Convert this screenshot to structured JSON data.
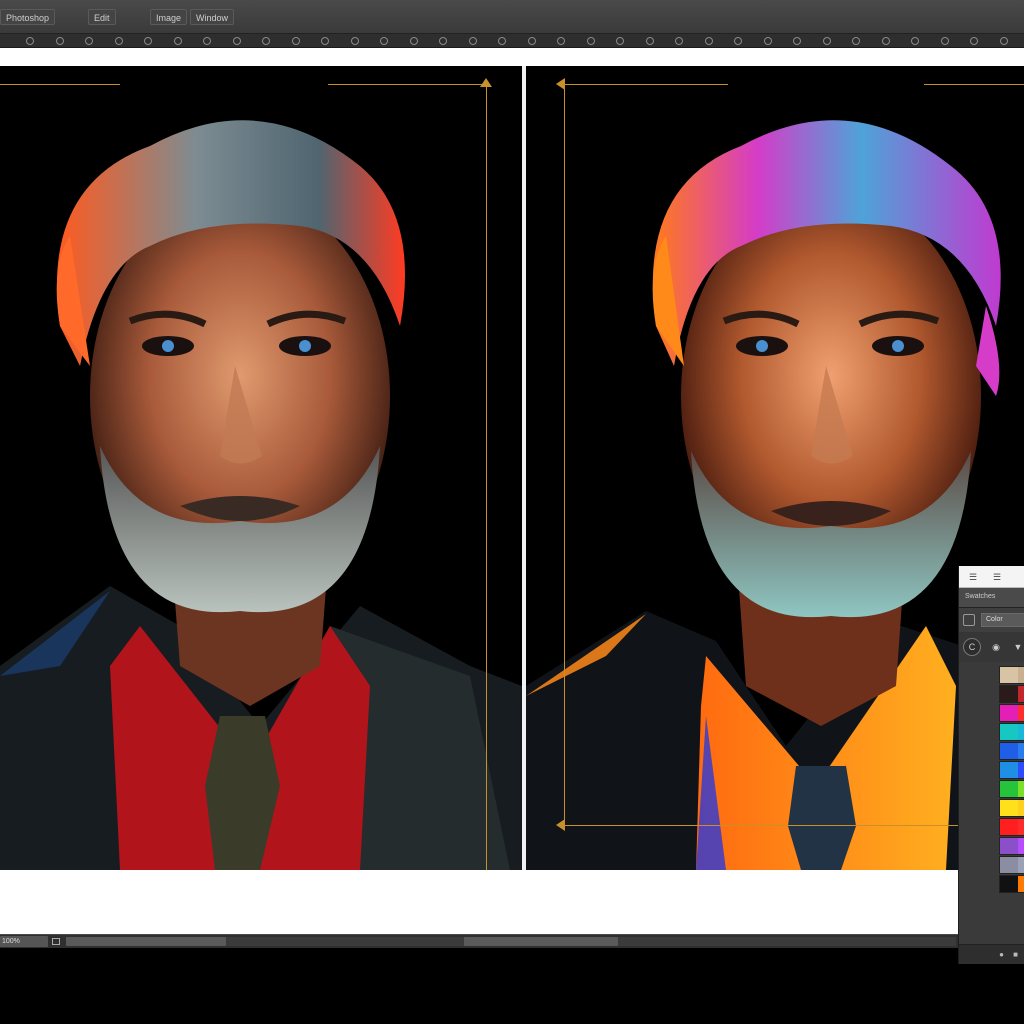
{
  "menubar": {
    "items": [
      "Photoshop",
      "Edit",
      "Image",
      "Window"
    ]
  },
  "optionbar": {
    "button_count": 34
  },
  "canvas": {
    "left_artwork": "portrait-original",
    "right_artwork": "portrait-color-variant",
    "background_color": "#000000",
    "guide_color": "#c8902a"
  },
  "statusbar": {
    "zoom": "100%"
  },
  "swatches_panel": {
    "tabs": [
      "☰",
      "☰"
    ],
    "header_label": "Swatches",
    "field_value": "Color",
    "menu_glyph": "▼",
    "search_glyph": "C",
    "swatch_rows": [
      [
        "#d8c3a5",
        "#c9b090"
      ],
      [
        "#2b1a1a",
        "#c0262c"
      ],
      [
        "#e31fb5",
        "#ff2e2e"
      ],
      [
        "#16c7c2",
        "#19b8d8"
      ],
      [
        "#1f5fe8",
        "#2a7df0"
      ],
      [
        "#1f8fe6",
        "#2d4cff"
      ],
      [
        "#26c43a",
        "#7be028"
      ],
      [
        "#ffe01a",
        "#ffd11f"
      ],
      [
        "#ff1f1f",
        "#ff2a2a"
      ],
      [
        "#8a4fc9",
        "#b94cff"
      ],
      [
        "#8b8ea3",
        "#9aa1b8"
      ],
      [
        "#111111",
        "#ff7a00"
      ]
    ]
  }
}
